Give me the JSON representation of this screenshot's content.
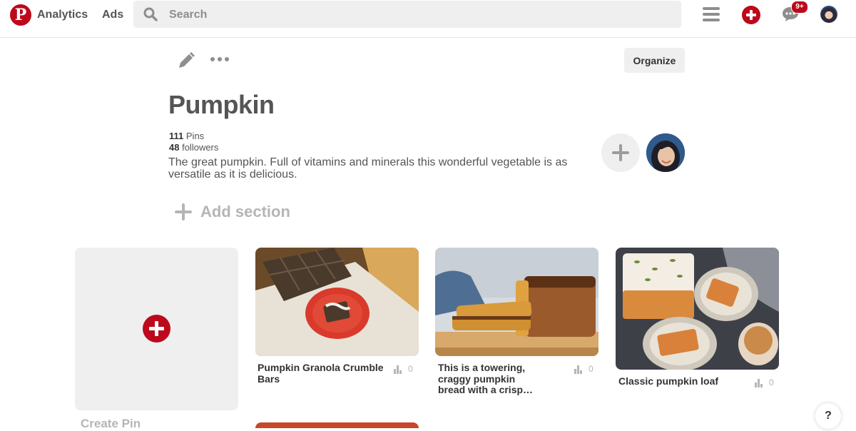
{
  "topbar": {
    "logo_letter": "P",
    "nav": {
      "analytics": "Analytics",
      "ads": "Ads"
    },
    "search": {
      "placeholder": "Search",
      "icon": "search-icon"
    },
    "notification_badge": "9+"
  },
  "board": {
    "title": "Pumpkin",
    "pins_count": "111",
    "pins_label": "Pins",
    "followers_count": "48",
    "followers_label": "followers",
    "description": "The great pumpkin. Full of vitamins and minerals this wonderful vegetable is as versatile as it is delicious.",
    "organize_label": "Organize",
    "add_section_label": "Add section"
  },
  "grid": {
    "create_pin_label": "Create Pin",
    "pins": [
      {
        "title": "Pumpkin Granola Crumble Bars",
        "stat": "0"
      },
      {
        "title": "This is a towering, craggy pumpkin bread with a crisp…",
        "stat": "0"
      },
      {
        "title": "Classic pumpkin loaf",
        "stat": "0"
      }
    ]
  },
  "help_label": "?",
  "colors": {
    "brand_red": "#bd081c",
    "surface_gray": "#efefef",
    "muted_text": "#8e8e8e"
  }
}
